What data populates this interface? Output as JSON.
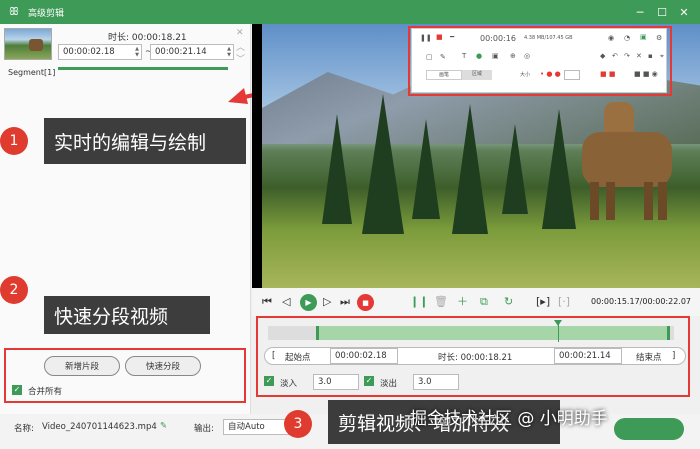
{
  "window": {
    "title": "高级剪辑"
  },
  "segment": {
    "label": "Segment[1]",
    "duration_label": "时长:",
    "duration": "00:00:18.21",
    "start": "00:00:02.18",
    "end": "00:00:21.14",
    "separator": "~"
  },
  "annotations": [
    {
      "number": "1",
      "text": "实时的编辑与绘制"
    },
    {
      "number": "2",
      "text": "快速分段视频"
    },
    {
      "number": "3",
      "text": "剪辑视频、增加特效"
    }
  ],
  "segment_buttons": {
    "new": "新增片段",
    "quick": "快速分段",
    "merge": "合并所有"
  },
  "file": {
    "name_label": "名称:",
    "name": "Video_240701144623.mp4",
    "output_label": "输出:",
    "output": "自动Auto"
  },
  "toolbox": {
    "time": "00:00:16",
    "size": "4.38 MB/107.45 GB",
    "mode_a": "画笔",
    "mode_b": "区域",
    "size_label": "大小"
  },
  "player": {
    "timecode": "00:00:15.17/00:00:22.07"
  },
  "range": {
    "start_btn": "起始点",
    "start": "00:00:02.18",
    "duration_label": "时长:",
    "duration": "00:00:18.21",
    "end": "00:00:21.14",
    "end_btn": "结束点"
  },
  "fade": {
    "in_label": "淡入",
    "in": "3.0",
    "out_label": "淡出",
    "out": "3.0"
  },
  "watermark": "掘金技术社区 @ 小明助手"
}
